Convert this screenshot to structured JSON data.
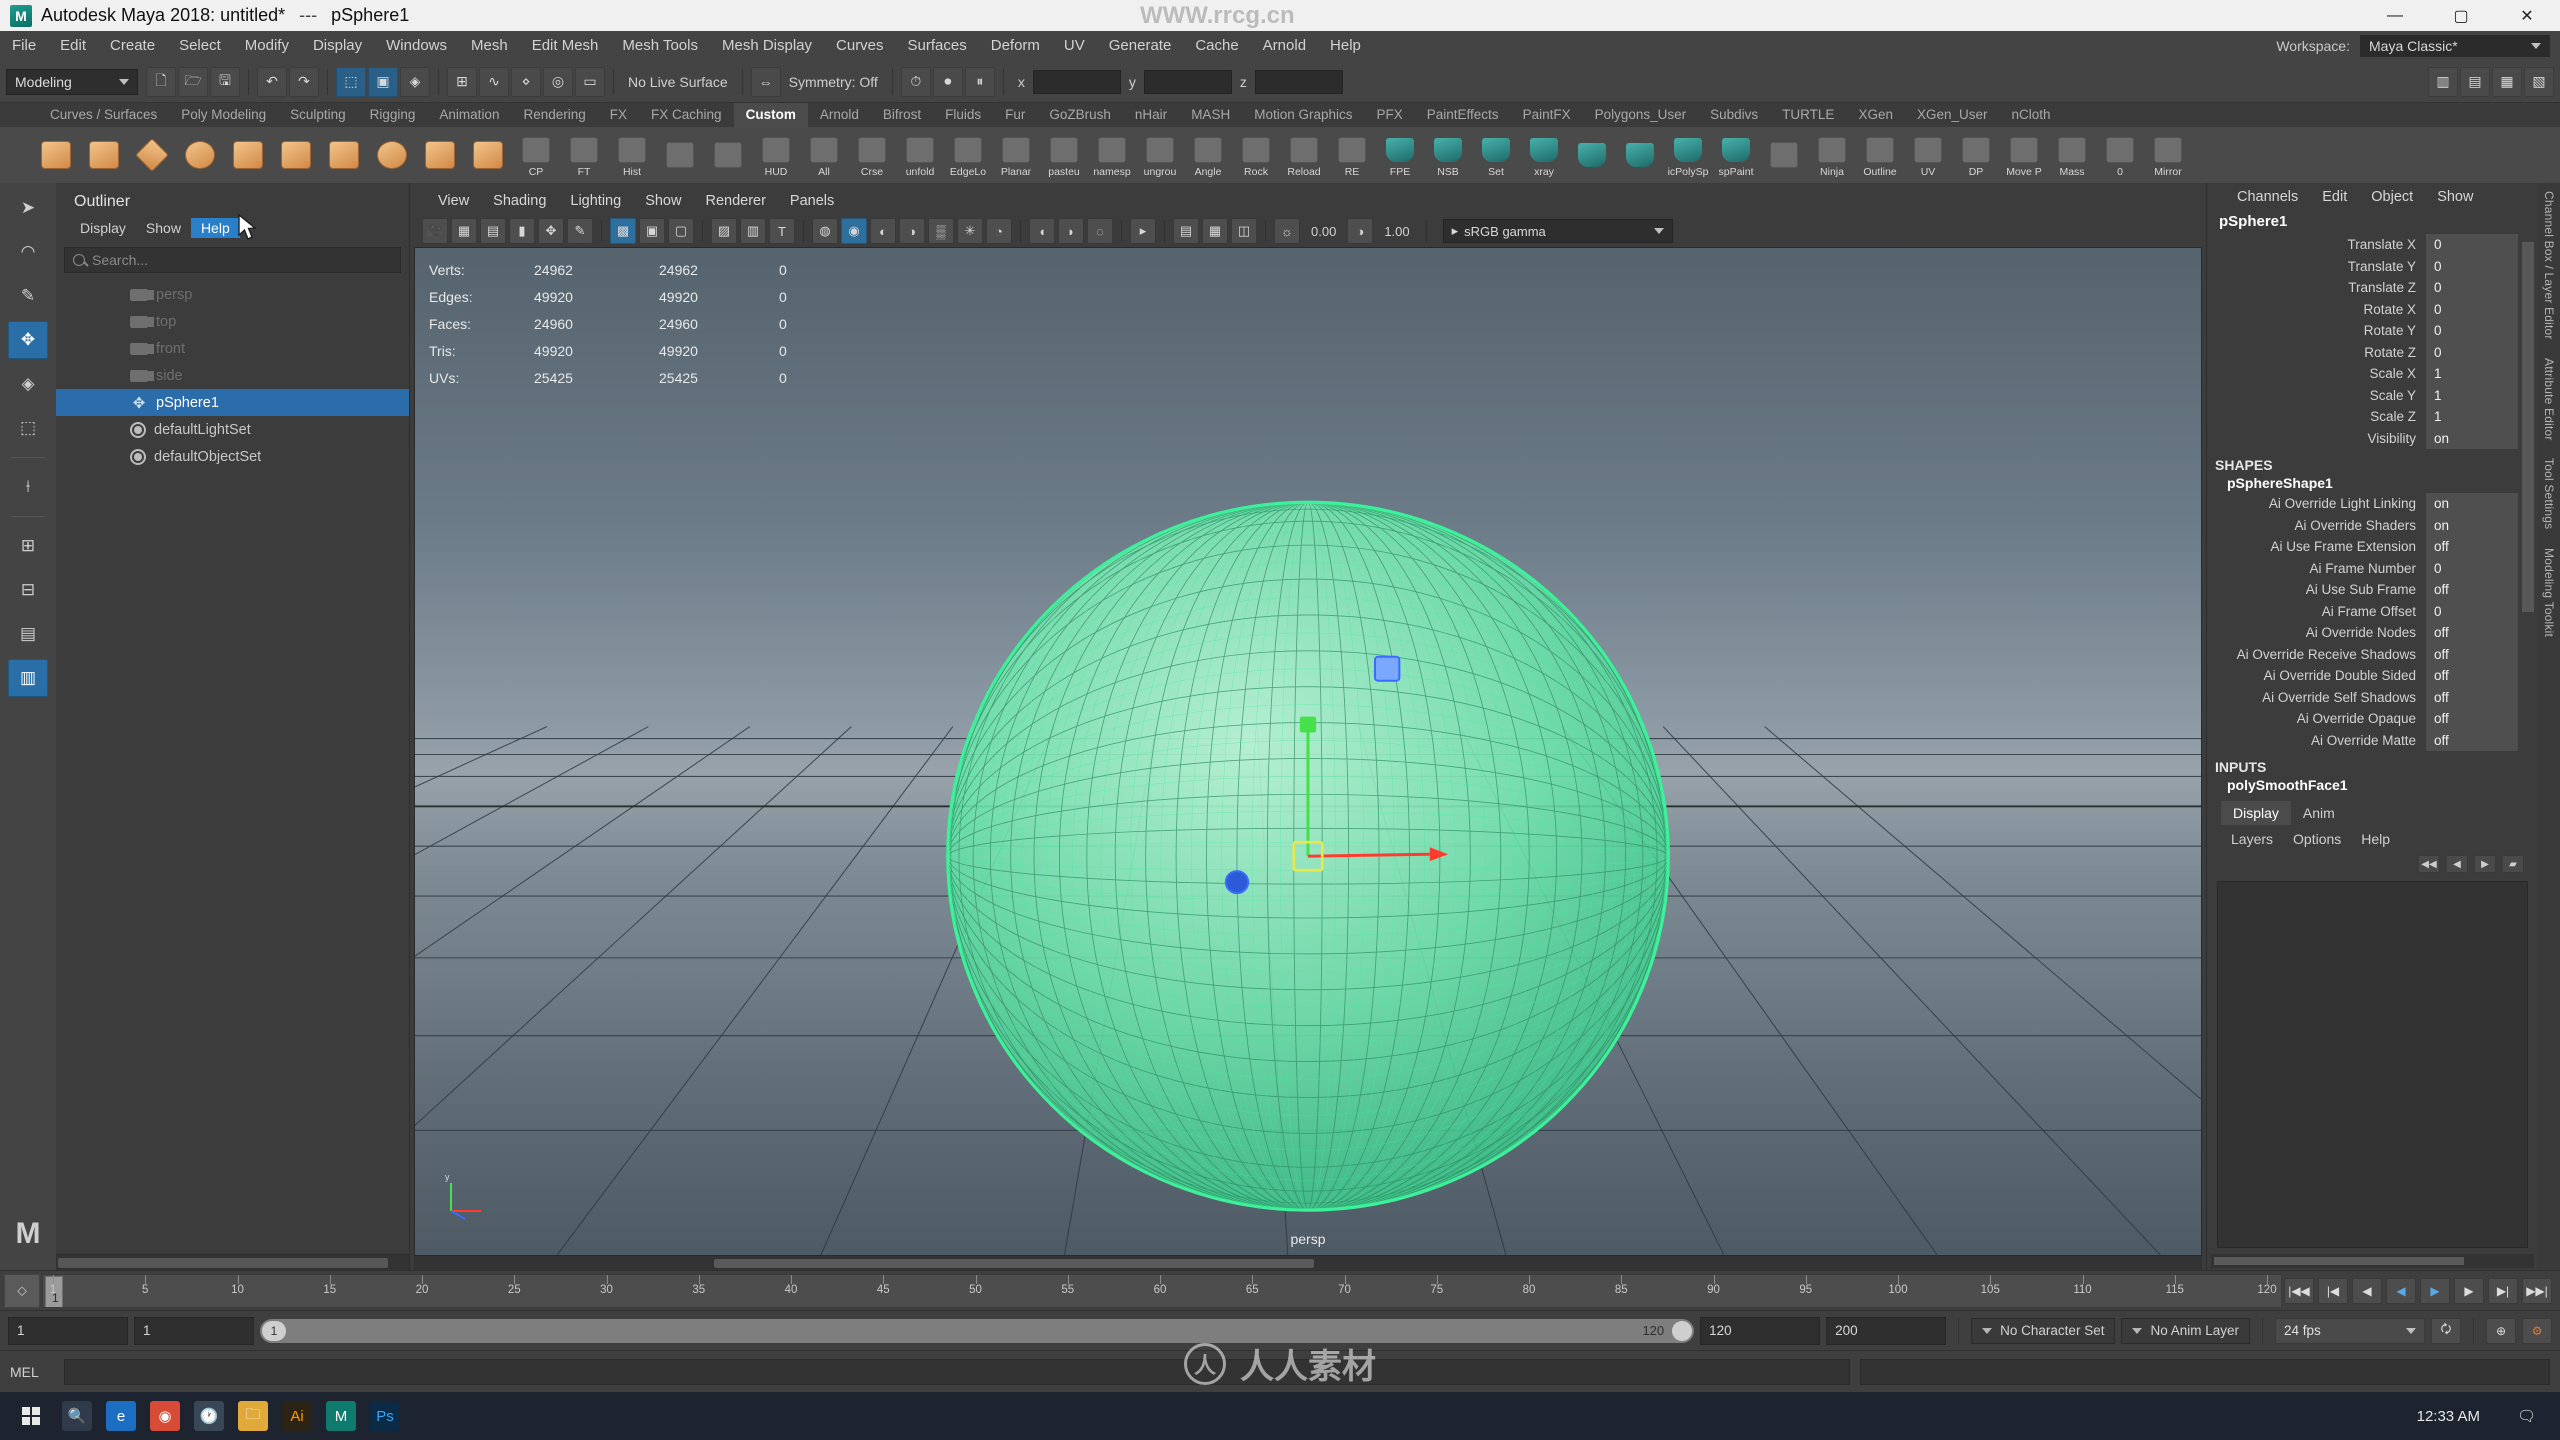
{
  "titlebar": {
    "app_title": "Autodesk Maya 2018: untitled*",
    "separator": "---",
    "selected_object": "pSphere1",
    "logo": "maya-logo-icon",
    "minimize": "—",
    "maximize": "▢",
    "close": "✕"
  },
  "menubar": {
    "items": [
      "File",
      "Edit",
      "Create",
      "Select",
      "Modify",
      "Display",
      "Windows",
      "Mesh",
      "Edit Mesh",
      "Mesh Tools",
      "Mesh Display",
      "Curves",
      "Surfaces",
      "Deform",
      "UV",
      "Generate",
      "Cache",
      "Arnold",
      "Help"
    ],
    "workspace_label": "Workspace:",
    "workspace_value": "Maya Classic*"
  },
  "statusline": {
    "mode": "Modeling",
    "live_surface": "No Live Surface",
    "symmetry": "Symmetry: Off",
    "coord_fields": [
      {
        "label": "x",
        "value": ""
      },
      {
        "label": "y",
        "value": ""
      },
      {
        "label": "z",
        "value": ""
      }
    ]
  },
  "shelf": {
    "tabs": [
      "Curves / Surfaces",
      "Poly Modeling",
      "Sculpting",
      "Rigging",
      "Animation",
      "Rendering",
      "FX",
      "FX Caching",
      "Custom",
      "Arnold",
      "Bifrost",
      "Fluids",
      "Fur",
      "GoZBrush",
      "nHair",
      "MASH",
      "Motion Graphics",
      "PFX",
      "PaintEffects",
      "PaintFX",
      "Polygons_User",
      "Subdivs",
      "TURTLE",
      "XGen",
      "XGen_User",
      "nCloth"
    ],
    "active_tab": "Custom",
    "buttons": [
      {
        "name": "poly-cube",
        "label": ""
      },
      {
        "name": "poly-cylinder",
        "label": ""
      },
      {
        "name": "poly-diamond",
        "label": ""
      },
      {
        "name": "poly-sphere",
        "label": ""
      },
      {
        "name": "poly-torus",
        "label": ""
      },
      {
        "name": "poly-plane",
        "label": ""
      },
      {
        "name": "poly-pipe",
        "label": ""
      },
      {
        "name": "poly-prism",
        "label": ""
      },
      {
        "name": "poly-pyramid",
        "label": ""
      },
      {
        "name": "poly-helix",
        "label": ""
      },
      {
        "name": "cp-tool",
        "label": "CP"
      },
      {
        "name": "ft-tool",
        "label": "FT"
      },
      {
        "name": "hist-tool",
        "label": "Hist"
      },
      {
        "name": "bar-tool",
        "label": ""
      },
      {
        "name": "sphere-tool",
        "label": ""
      },
      {
        "name": "hud-tool",
        "label": "HUD"
      },
      {
        "name": "all-tool",
        "label": "All"
      },
      {
        "name": "crease-tool",
        "label": "Crse"
      },
      {
        "name": "unfold-tool",
        "label": "unfold"
      },
      {
        "name": "edgeloop-tool",
        "label": "EdgeLo"
      },
      {
        "name": "planar-tool",
        "label": "Planar"
      },
      {
        "name": "paste-tool",
        "label": "pasteu"
      },
      {
        "name": "namespace-tool",
        "label": "namesp"
      },
      {
        "name": "group-tool",
        "label": "ungrou"
      },
      {
        "name": "angle-tool",
        "label": "Angle"
      },
      {
        "name": "rock-tool",
        "label": "Rock"
      },
      {
        "name": "reload-tool",
        "label": "Reload"
      },
      {
        "name": "re-tool",
        "label": "RE"
      },
      {
        "name": "fpe-tool",
        "label": "FPE"
      },
      {
        "name": "nsb-tool",
        "label": "NSB"
      },
      {
        "name": "set-tool",
        "label": "Set"
      },
      {
        "name": "xray-tool",
        "label": "xray"
      },
      {
        "name": "brush-tool",
        "label": ""
      },
      {
        "name": "select-tool",
        "label": ""
      },
      {
        "name": "polysplit-tool",
        "label": "icPolySp"
      },
      {
        "name": "spaint-tool",
        "label": "spPaint"
      },
      {
        "name": "world-tool",
        "label": ""
      },
      {
        "name": "ninja-tool",
        "label": "Ninja"
      },
      {
        "name": "outline-tool",
        "label": "Outline"
      },
      {
        "name": "uv-editor-tool",
        "label": "UV"
      },
      {
        "name": "dp-tool",
        "label": "DP"
      },
      {
        "name": "move-pmass-tool",
        "label": "Move P"
      },
      {
        "name": "mass-tool",
        "label": "Mass"
      },
      {
        "name": "zero-tool",
        "label": "0"
      },
      {
        "name": "mirror-tool",
        "label": "Mirror"
      }
    ]
  },
  "toolbox": {
    "items": [
      "select-tool-icon",
      "lasso-tool-icon",
      "paint-select-tool-icon",
      "move-tool-icon",
      "rotate-tool-icon",
      "scale-tool-icon",
      "last-tool-icon",
      "show-manipulator-icon",
      "four-view-layout-icon",
      "two-panes-stacked-icon",
      "persp-outliner-layout-icon",
      "hypergraph-layout-icon"
    ]
  },
  "outliner": {
    "title": "Outliner",
    "menu": [
      "Display",
      "Show",
      "Help"
    ],
    "hovered_menu": "Help",
    "search_placeholder": "Search...",
    "items": [
      {
        "label": "persp",
        "icon": "camera-icon",
        "state": "dim"
      },
      {
        "label": "top",
        "icon": "camera-icon",
        "state": "dim"
      },
      {
        "label": "front",
        "icon": "camera-icon",
        "state": "dim"
      },
      {
        "label": "side",
        "icon": "camera-icon",
        "state": "dim"
      },
      {
        "label": "pSphere1",
        "icon": "transform-icon",
        "state": "selected"
      },
      {
        "label": "defaultLightSet",
        "icon": "set-icon",
        "state": "normal"
      },
      {
        "label": "defaultObjectSet",
        "icon": "set-icon",
        "state": "normal"
      }
    ]
  },
  "viewport": {
    "menu": [
      "View",
      "Shading",
      "Lighting",
      "Show",
      "Renderer",
      "Panels"
    ],
    "toolbar_values": {
      "exposure": "0.00",
      "gamma": "1.00"
    },
    "color_space": "sRGB gamma",
    "camera_label": "persp",
    "hud": {
      "columns": 3,
      "rows": [
        {
          "label": "Verts:",
          "total": "24962",
          "selected": "24962",
          "other": "0"
        },
        {
          "label": "Edges:",
          "total": "49920",
          "selected": "49920",
          "other": "0"
        },
        {
          "label": "Faces:",
          "total": "24960",
          "selected": "24960",
          "other": "0"
        },
        {
          "label": "Tris:",
          "total": "49920",
          "selected": "49920",
          "other": "0"
        },
        {
          "label": "UVs:",
          "total": "25425",
          "selected": "25425",
          "other": "0"
        }
      ]
    },
    "selection_color": "#3df09a",
    "manipulator": {
      "x_axis": "#ff3b30",
      "y_axis": "#46e04a",
      "z_axis": "#3b6bff",
      "center": "#e8e84a"
    }
  },
  "channelbox": {
    "menu": [
      "Channels",
      "Edit",
      "Object",
      "Show"
    ],
    "object_name": "pSphere1",
    "transform_attrs": [
      {
        "label": "Translate X",
        "value": "0"
      },
      {
        "label": "Translate Y",
        "value": "0"
      },
      {
        "label": "Translate Z",
        "value": "0"
      },
      {
        "label": "Rotate X",
        "value": "0"
      },
      {
        "label": "Rotate Y",
        "value": "0"
      },
      {
        "label": "Rotate Z",
        "value": "0"
      },
      {
        "label": "Scale X",
        "value": "1"
      },
      {
        "label": "Scale Y",
        "value": "1"
      },
      {
        "label": "Scale Z",
        "value": "1"
      },
      {
        "label": "Visibility",
        "value": "on"
      }
    ],
    "shapes_header": "SHAPES",
    "shape_name": "pSphereShape1",
    "shape_attrs": [
      {
        "label": "Ai Override Light Linking",
        "value": "on"
      },
      {
        "label": "Ai Override Shaders",
        "value": "on"
      },
      {
        "label": "Ai Use Frame Extension",
        "value": "off"
      },
      {
        "label": "Ai Frame Number",
        "value": "0"
      },
      {
        "label": "Ai Use Sub Frame",
        "value": "off"
      },
      {
        "label": "Ai Frame Offset",
        "value": "0"
      },
      {
        "label": "Ai Override Nodes",
        "value": "off"
      },
      {
        "label": "Ai Override Receive Shadows",
        "value": "off"
      },
      {
        "label": "Ai Override Double Sided",
        "value": "off"
      },
      {
        "label": "Ai Override Self Shadows",
        "value": "off"
      },
      {
        "label": "Ai Override Opaque",
        "value": "off"
      },
      {
        "label": "Ai Override Matte",
        "value": "off"
      }
    ],
    "inputs_header": "INPUTS",
    "inputs": [
      "polySmoothFace1"
    ],
    "side_tabs": [
      "Channel Box / Layer Editor",
      "Attribute Editor",
      "Tool Settings",
      "Modeling Toolkit"
    ]
  },
  "layereditor": {
    "tabs": [
      "Display",
      "Anim"
    ],
    "active_tab": "Display",
    "menu": [
      "Layers",
      "Options",
      "Help"
    ],
    "buttons": [
      "layer-prev-icon",
      "layer-play-icon",
      "layer-next-icon",
      "layer-new-icon"
    ]
  },
  "timeslider": {
    "key_button": "key-icon",
    "current_frame": "1",
    "ticks": [
      "1",
      "5",
      "10",
      "15",
      "20",
      "25",
      "30",
      "35",
      "40",
      "45",
      "50",
      "55",
      "60",
      "65",
      "70",
      "75",
      "80",
      "85",
      "90",
      "95",
      "100",
      "105",
      "110",
      "115",
      "120"
    ],
    "playback_buttons": [
      "go-to-start-icon",
      "step-back-key-icon",
      "step-back-frame-icon",
      "play-backwards-icon",
      "play-forwards-icon",
      "step-forward-frame-icon",
      "step-forward-key-icon",
      "go-to-end-icon"
    ]
  },
  "rangeslider": {
    "anim_start": "1",
    "range_start": "1",
    "bar_left_label": "1",
    "bar_right_label": "120",
    "range_end": "120",
    "anim_end": "200",
    "character_set": "No Character Set",
    "anim_layer": "No Anim Layer",
    "fps": "24 fps",
    "auto_key": "auto-key-icon",
    "anim_prefs": "animation-preferences-icon",
    "cycle": "playback-loop-icon"
  },
  "commandline": {
    "language": "MEL",
    "input_value": "",
    "output_value": ""
  },
  "taskbar": {
    "start": "windows-start-icon",
    "items": [
      "search-icon",
      "edge-icon",
      "chrome-icon",
      "clock-icon",
      "folder-icon",
      "illustrator-icon",
      "maya-icon",
      "photoshop-icon"
    ],
    "clock": "12:33 AM",
    "notification": "notification-icon"
  },
  "watermark": {
    "top_text": "WWW.rrcg.cn",
    "bottom_text": "人人素材",
    "bottom_icon": "watermark-logo-icon"
  }
}
